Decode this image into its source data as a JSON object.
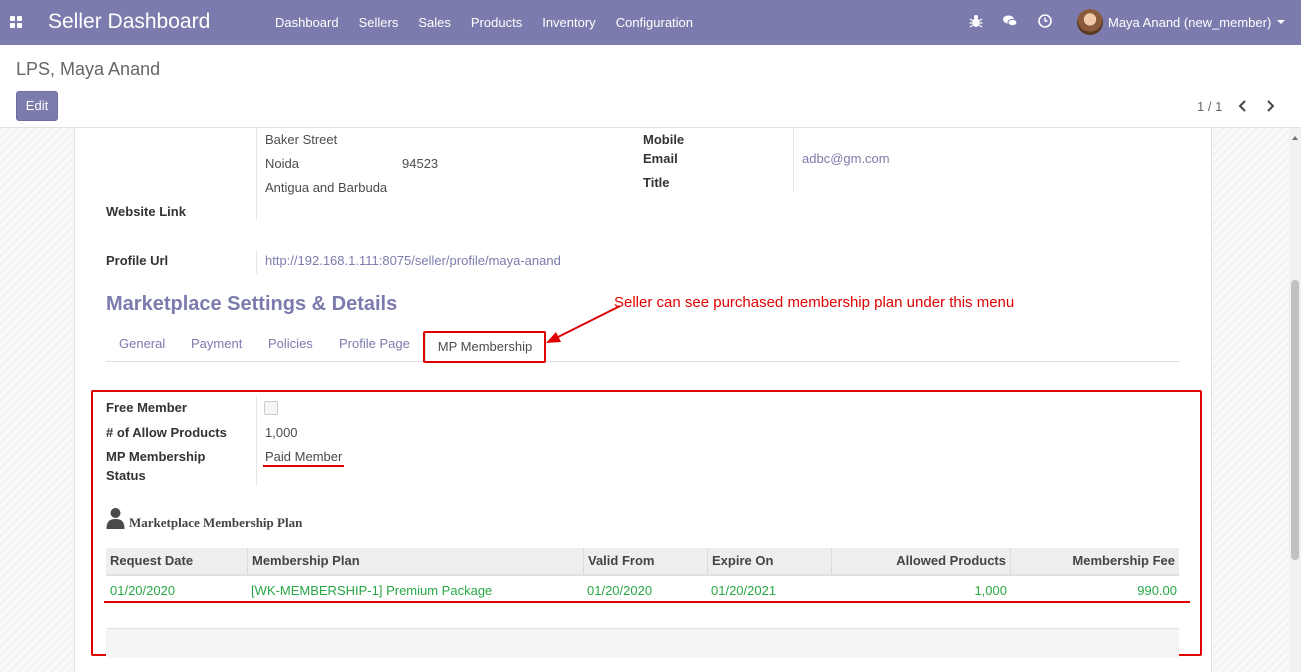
{
  "navbar": {
    "brand": "Seller Dashboard",
    "menu": [
      "Dashboard",
      "Sellers",
      "Sales",
      "Products",
      "Inventory",
      "Configuration"
    ],
    "user": "Maya Anand (new_member)",
    "icons": [
      "bug-icon",
      "chat-icon",
      "clock-icon"
    ]
  },
  "control": {
    "breadcrumb": "LPS, Maya Anand",
    "edit_label": "Edit",
    "pager": "1 / 1"
  },
  "address": {
    "street": "Baker Street",
    "city": "Noida",
    "zip": "94523",
    "country": "Antigua and Barbuda"
  },
  "fields": {
    "website_label": "Website Link",
    "profile_url_label": "Profile Url",
    "profile_url": "http://192.168.1.111:8075/seller/profile/maya-anand",
    "mobile_label": "Mobile",
    "email_label": "Email",
    "email": "adbc@gm.com",
    "title_label": "Title"
  },
  "section": {
    "title": "Marketplace Settings & Details",
    "annotation": "Seller can see purchased membership plan under this menu",
    "tabs": [
      "General",
      "Payment",
      "Policies",
      "Profile Page",
      "MP Membership"
    ],
    "active_tab": "MP Membership"
  },
  "membership": {
    "free_member_label": "Free Member",
    "free_member_checked": false,
    "allow_products_label": "# of Allow Products",
    "allow_products": "1,000",
    "status_label_1": "MP Membership",
    "status_label_2": "Status",
    "status": "Paid Member",
    "plan_heading": "Marketplace Membership Plan"
  },
  "table": {
    "headers": [
      "Request Date",
      "Membership Plan",
      "Valid From",
      "Expire On",
      "Allowed Products",
      "Membership Fee"
    ],
    "rows": [
      [
        "01/20/2020",
        "[WK-MEMBERSHIP-1] Premium Package",
        "01/20/2020",
        "01/20/2021",
        "1,000",
        "990.00"
      ]
    ]
  },
  "colors": {
    "brand": "#7c7bad",
    "annotation": "#e10000",
    "row_text": "#28a745"
  }
}
